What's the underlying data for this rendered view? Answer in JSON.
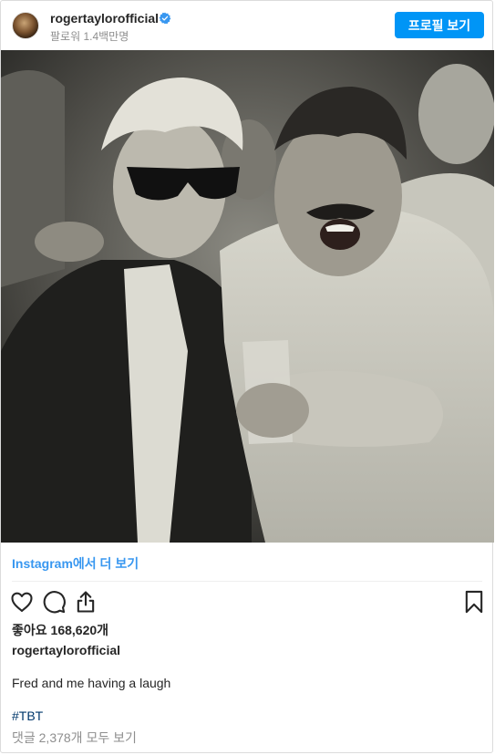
{
  "header": {
    "username": "rogertaylorofficial",
    "followers": "팔로워 1.4백만명",
    "profile_button": "프로필 보기"
  },
  "view_more": "Instagram에서 더 보기",
  "likes": "좋아요 168,620개",
  "caption": {
    "username": "rogertaylorofficial",
    "text": "Fred and me having a laugh",
    "hashtag": "#TBT"
  },
  "comments": "댓글 2,378개 모두 보기",
  "colors": {
    "accent": "#0095f6",
    "link": "#3897f0",
    "hashtag": "#00376b",
    "muted": "#8e8e8e"
  }
}
